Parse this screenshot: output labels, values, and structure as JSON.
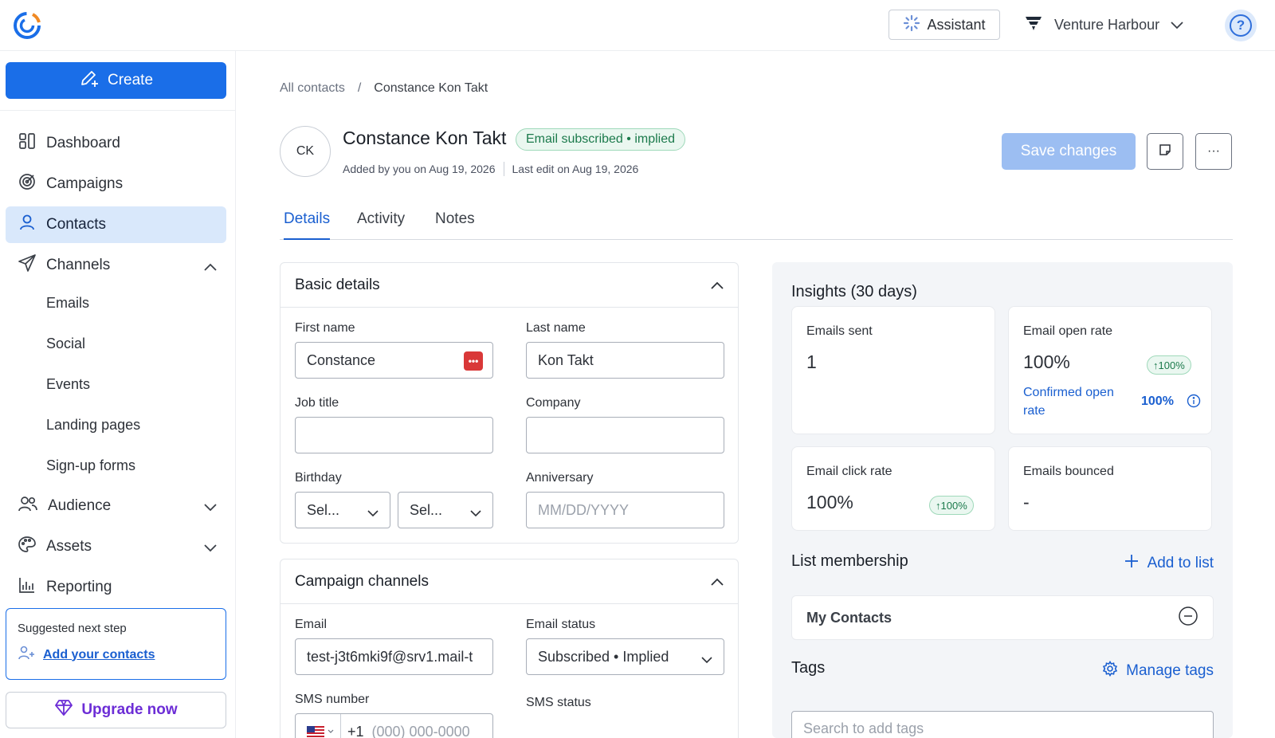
{
  "header": {
    "assistant_label": "Assistant",
    "account_name": "Venture Harbour"
  },
  "sidebar": {
    "create_label": "Create",
    "items": [
      {
        "label": "Dashboard"
      },
      {
        "label": "Campaigns"
      },
      {
        "label": "Contacts"
      },
      {
        "label": "Channels"
      },
      {
        "label": "Audience"
      },
      {
        "label": "Assets"
      },
      {
        "label": "Reporting"
      }
    ],
    "channels_sub": [
      "Emails",
      "Social",
      "Events",
      "Landing pages",
      "Sign-up forms"
    ],
    "suggested": {
      "title": "Suggested next step",
      "link": "Add your contacts"
    },
    "upgrade_label": "Upgrade now"
  },
  "breadcrumb": {
    "root": "All contacts",
    "separator": "/",
    "current": "Constance Kon Takt"
  },
  "contact": {
    "initials": "CK",
    "name": "Constance Kon Takt",
    "status_badge": "Email subscribed • implied",
    "added_by": "Added by you on Aug 19, 2026",
    "last_edit": "Last edit on Aug 19, 2026"
  },
  "actions": {
    "save_label": "Save changes",
    "more_label": "···"
  },
  "tabs": [
    {
      "label": "Details",
      "active": true
    },
    {
      "label": "Activity",
      "active": false
    },
    {
      "label": "Notes",
      "active": false
    }
  ],
  "basic_details": {
    "title": "Basic details",
    "first_name_label": "First name",
    "first_name_value": "Constance",
    "last_name_label": "Last name",
    "last_name_value": "Kon Takt",
    "job_title_label": "Job title",
    "job_title_value": "",
    "company_label": "Company",
    "company_value": "",
    "birthday_label": "Birthday",
    "birthday_month": "Sel...",
    "birthday_day": "Sel...",
    "anniversary_label": "Anniversary",
    "anniversary_placeholder": "MM/DD/YYYY"
  },
  "campaign_channels": {
    "title": "Campaign channels",
    "email_label": "Email",
    "email_value": "test-j3t6mki9f@srv1.mail-t",
    "email_status_label": "Email status",
    "email_status_value": "Subscribed • Implied",
    "sms_number_label": "SMS number",
    "sms_country_code": "+1",
    "sms_placeholder": "(000) 000-0000",
    "sms_status_label": "SMS status"
  },
  "insights": {
    "title": "Insights (30 days)",
    "emails_sent_label": "Emails sent",
    "emails_sent_value": "1",
    "open_rate_label": "Email open rate",
    "open_rate_value": "100%",
    "open_rate_delta": "↑100%",
    "confirmed_open_label": "Confirmed open rate",
    "confirmed_open_value": "100%",
    "click_rate_label": "Email click rate",
    "click_rate_value": "100%",
    "click_rate_delta": "↑100%",
    "bounced_label": "Emails bounced",
    "bounced_value": "-"
  },
  "list_membership": {
    "title": "List membership",
    "add_label": "Add to list",
    "items": [
      "My Contacts"
    ]
  },
  "tags": {
    "title": "Tags",
    "manage_label": "Manage tags",
    "search_placeholder": "Search to add tags"
  },
  "colors": {
    "primary": "#1a6ee8",
    "active_nav_bg": "#d9e8fb",
    "success": "#1c7a4c",
    "upgrade": "#6c2dd6"
  }
}
